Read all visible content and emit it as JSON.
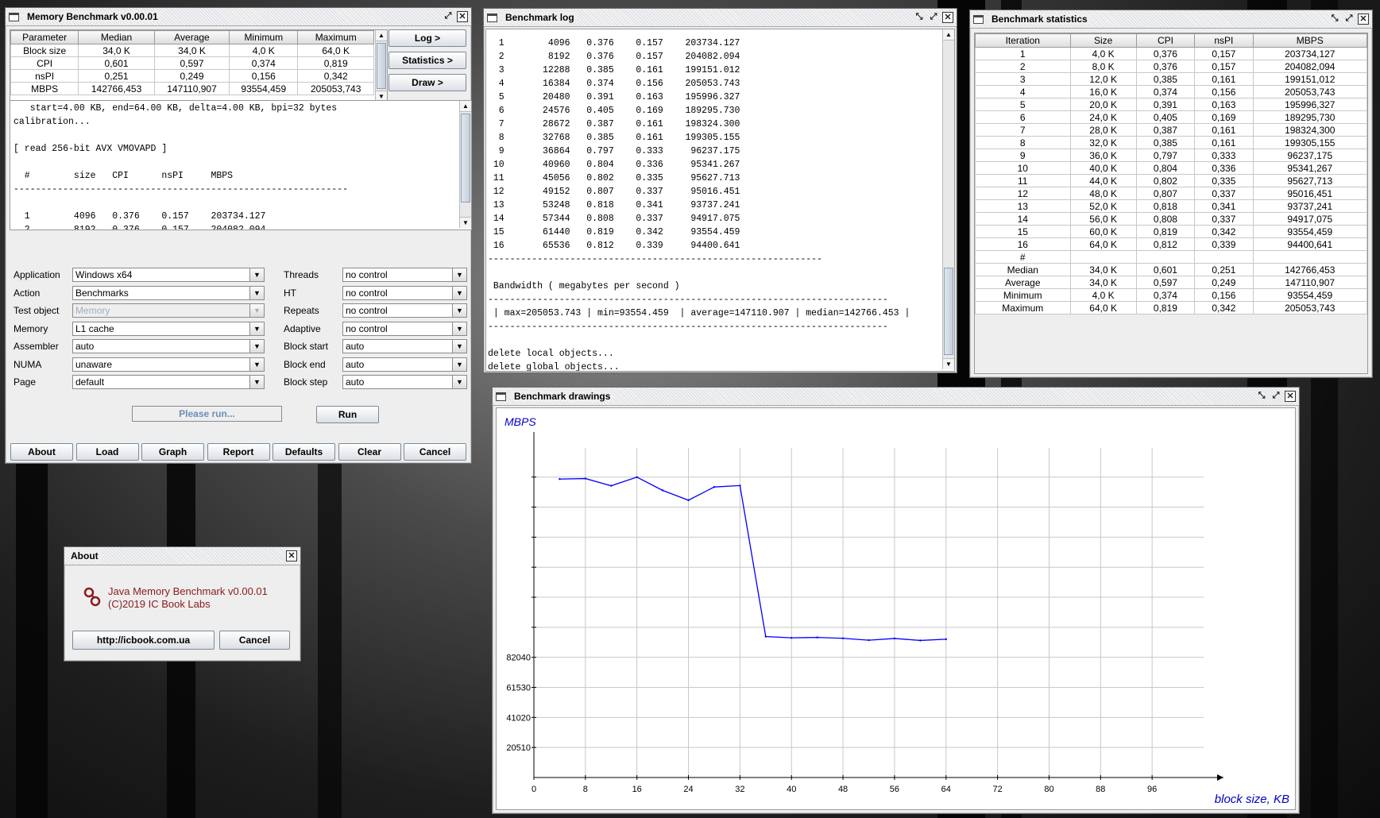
{
  "main_window": {
    "title": "Memory Benchmark v0.00.01",
    "summary_headers": [
      "Parameter",
      "Median",
      "Average",
      "Minimum",
      "Maximum"
    ],
    "summary_rows": [
      [
        "Block size",
        "34,0 K",
        "34,0 K",
        "4,0 K",
        "64,0 K"
      ],
      [
        "CPI",
        "0,601",
        "0,597",
        "0,374",
        "0,819"
      ],
      [
        "nsPI",
        "0,251",
        "0,249",
        "0,156",
        "0,342"
      ],
      [
        "MBPS",
        "142766,453",
        "147110,907",
        "93554,459",
        "205053,743"
      ]
    ],
    "side_buttons": [
      "Log >",
      "Statistics >",
      "Draw >"
    ],
    "log_lines": [
      "   start=4.00 KB, end=64.00 KB, delta=4.00 KB, bpi=32 bytes",
      "calibration...",
      "",
      "[ read 256-bit AVX VMOVAPD ]",
      "",
      "  #        size   CPI      nsPI     MBPS",
      "-------------------------------------------------------------",
      "",
      "  1        4096   0.376    0.157    203734.127",
      "  2        8192   0.376    0.157    204082.094"
    ],
    "options_left": [
      {
        "label": "Application",
        "value": "Windows x64"
      },
      {
        "label": "Action",
        "value": "Benchmarks"
      },
      {
        "label": "Test object",
        "value": "Memory",
        "disabled": true
      },
      {
        "label": "Memory",
        "value": "L1 cache"
      },
      {
        "label": "Assembler",
        "value": "auto"
      },
      {
        "label": "NUMA",
        "value": "unaware"
      },
      {
        "label": "Page",
        "value": "default"
      }
    ],
    "options_right": [
      {
        "label": "Threads",
        "value": "no control"
      },
      {
        "label": "HT",
        "value": "no control"
      },
      {
        "label": "Repeats",
        "value": "no control"
      },
      {
        "label": "Adaptive",
        "value": "no control"
      },
      {
        "label": "Block start",
        "value": "auto"
      },
      {
        "label": "Block end",
        "value": "auto"
      },
      {
        "label": "Block step",
        "value": "auto"
      }
    ],
    "status_text": "Please run...",
    "run_label": "Run",
    "bottom_buttons": [
      "About",
      "Load",
      "Graph",
      "Report",
      "Defaults",
      "Clear",
      "Cancel"
    ]
  },
  "log_window": {
    "title": "Benchmark log",
    "lines": [
      "  1        4096   0.376    0.157    203734.127",
      "  2        8192   0.376    0.157    204082.094",
      "  3       12288   0.385    0.161    199151.012",
      "  4       16384   0.374    0.156    205053.743",
      "  5       20480   0.391    0.163    195996.327",
      "  6       24576   0.405    0.169    189295.730",
      "  7       28672   0.387    0.161    198324.300",
      "  8       32768   0.385    0.161    199305.155",
      "  9       36864   0.797    0.333     96237.175",
      " 10       40960   0.804    0.336     95341.267",
      " 11       45056   0.802    0.335     95627.713",
      " 12       49152   0.807    0.337     95016.451",
      " 13       53248   0.818    0.341     93737.241",
      " 14       57344   0.808    0.337     94917.075",
      " 15       61440   0.819    0.342     93554.459",
      " 16       65536   0.812    0.339     94400.641",
      "-------------------------------------------------------------",
      "",
      " Bandwidth ( megabytes per second )",
      "-------------------------------------------------------------------------",
      " | max=205053.743 | min=93554.459  | average=147110.907 | median=142766.453 |",
      "-------------------------------------------------------------------------",
      "",
      "delete local objects...",
      "delete global objects..."
    ]
  },
  "stats_window": {
    "title": "Benchmark statistics",
    "headers": [
      "Iteration",
      "Size",
      "CPI",
      "nsPI",
      "MBPS"
    ],
    "rows": [
      [
        "1",
        "4,0 K",
        "0,376",
        "0,157",
        "203734,127"
      ],
      [
        "2",
        "8,0 K",
        "0,376",
        "0,157",
        "204082,094"
      ],
      [
        "3",
        "12,0 K",
        "0,385",
        "0,161",
        "199151,012"
      ],
      [
        "4",
        "16,0 K",
        "0,374",
        "0,156",
        "205053,743"
      ],
      [
        "5",
        "20,0 K",
        "0,391",
        "0,163",
        "195996,327"
      ],
      [
        "6",
        "24,0 K",
        "0,405",
        "0,169",
        "189295,730"
      ],
      [
        "7",
        "28,0 K",
        "0,387",
        "0,161",
        "198324,300"
      ],
      [
        "8",
        "32,0 K",
        "0,385",
        "0,161",
        "199305,155"
      ],
      [
        "9",
        "36,0 K",
        "0,797",
        "0,333",
        "96237,175"
      ],
      [
        "10",
        "40,0 K",
        "0,804",
        "0,336",
        "95341,267"
      ],
      [
        "11",
        "44,0 K",
        "0,802",
        "0,335",
        "95627,713"
      ],
      [
        "12",
        "48,0 K",
        "0,807",
        "0,337",
        "95016,451"
      ],
      [
        "13",
        "52,0 K",
        "0,818",
        "0,341",
        "93737,241"
      ],
      [
        "14",
        "56,0 K",
        "0,808",
        "0,337",
        "94917,075"
      ],
      [
        "15",
        "60,0 K",
        "0,819",
        "0,342",
        "93554,459"
      ],
      [
        "16",
        "64,0 K",
        "0,812",
        "0,339",
        "94400,641"
      ],
      [
        "#",
        "",
        "",
        "",
        ""
      ],
      [
        "Median",
        "34,0 K",
        "0,601",
        "0,251",
        "142766,453"
      ],
      [
        "Average",
        "34,0 K",
        "0,597",
        "0,249",
        "147110,907"
      ],
      [
        "Minimum",
        "4,0 K",
        "0,374",
        "0,156",
        "93554,459"
      ],
      [
        "Maximum",
        "64,0 K",
        "0,819",
        "0,342",
        "205053,743"
      ]
    ]
  },
  "draw_window": {
    "title": "Benchmark drawings"
  },
  "chart_data": {
    "type": "line",
    "ylabel": "MBPS",
    "xlabel": "block size, KB",
    "x_ticks": [
      0,
      8,
      16,
      24,
      32,
      40,
      48,
      56,
      64,
      72,
      80,
      88,
      96
    ],
    "y_ticks": [
      20510,
      41020,
      61530,
      82040
    ],
    "xlim": [
      0,
      104
    ],
    "ylim": [
      0,
      225000
    ],
    "grid": true,
    "line_color": "#0000ff",
    "series": [
      {
        "x": [
          4,
          8,
          12,
          16,
          20,
          24,
          28,
          32,
          36,
          40,
          44,
          48,
          52,
          56,
          60,
          64
        ],
        "y": [
          203734.127,
          204082.094,
          199151.012,
          205053.743,
          195996.327,
          189295.73,
          198324.3,
          199305.155,
          96237.175,
          95341.267,
          95627.713,
          95016.451,
          93737.241,
          94917.075,
          93554.459,
          94400.641
        ]
      }
    ]
  },
  "about_window": {
    "title": "About",
    "line1": "Java Memory Benchmark v0.00.01",
    "line2": "(C)2019 IC Book Labs",
    "link_label": "http://icbook.com.ua",
    "cancel_label": "Cancel",
    "text_color": "#8b1a1a"
  }
}
